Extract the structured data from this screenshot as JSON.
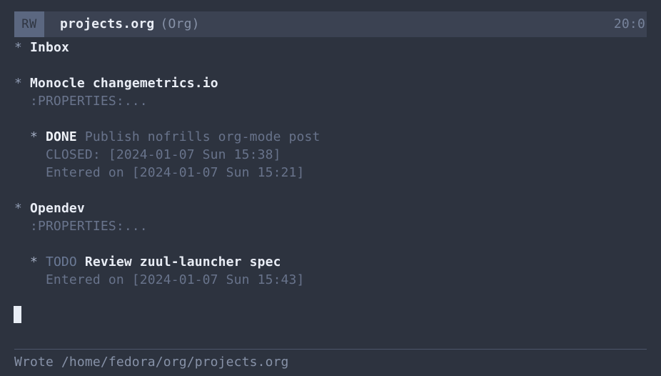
{
  "window": {
    "background_color": "#2d333f",
    "header": {
      "modified_badge": "RW",
      "file_name": "projects.org",
      "major_mode": "(Org)",
      "clock": "20:0",
      "bar_color": "#3b4252",
      "badge_color": "#5b6780"
    }
  },
  "buffer": {
    "lines": [
      {
        "bullet": "*",
        "text": "Inbox",
        "kind": "headline-1"
      },
      {
        "bullet": "",
        "text": "",
        "kind": "blank"
      },
      {
        "bullet": "*",
        "text": "Monocle changemetrics.io",
        "kind": "headline-1"
      },
      {
        "bullet": "",
        "text": ":PROPERTIES:...",
        "kind": "drawer"
      },
      {
        "bullet": "",
        "text": "",
        "kind": "blank"
      },
      {
        "bullet": "*",
        "keyword": "DONE",
        "text": "Publish nofrills org-mode post",
        "kind": "todo-item-done"
      },
      {
        "bullet": "",
        "text": "CLOSED: [2024-01-07 Sun 15:38]",
        "kind": "timestamp"
      },
      {
        "bullet": "",
        "text": "Entered on [2024-01-07 Sun 15:21]",
        "kind": "timestamp"
      },
      {
        "bullet": "",
        "text": "",
        "kind": "blank"
      },
      {
        "bullet": "*",
        "text": "Opendev",
        "kind": "headline-1"
      },
      {
        "bullet": "",
        "text": ":PROPERTIES:...",
        "kind": "drawer"
      },
      {
        "bullet": "",
        "text": "",
        "kind": "blank"
      },
      {
        "bullet": "*",
        "keyword": "TODO",
        "text": "Review zuul-launcher spec",
        "kind": "todo-item-todo"
      },
      {
        "bullet": "",
        "text": "Entered on [2024-01-07 Sun 15:43]",
        "kind": "timestamp"
      }
    ],
    "line_01_bullet": "*",
    "line_01_text": "Inbox",
    "line_03_bullet": "*",
    "line_03_text": "Monocle changemetrics.io",
    "line_04_text": "  :PROPERTIES:...",
    "line_06_bullet": "  * ",
    "line_06_keyword": "DONE",
    "line_06_text": " Publish nofrills org-mode post",
    "line_07_text": "    CLOSED: [2024-01-07 Sun 15:38]",
    "line_08_text": "    Entered on [2024-01-07 Sun 15:21]",
    "line_10_bullet": "*",
    "line_10_text": "Opendev",
    "line_11_text": "  :PROPERTIES:...",
    "line_13_bullet": "  * ",
    "line_13_keyword": "TODO",
    "line_13_text": " Review zuul-launcher spec",
    "line_14_text": "    Entered on [2024-01-07 Sun 15:43]"
  },
  "cursor": {
    "shape": "block",
    "color": "#e8edf5"
  },
  "minibuffer": {
    "message": "Wrote /home/fedora/org/projects.org"
  },
  "colors": {
    "foreground": "#e9edf5",
    "dimmed": "#68738b",
    "todo_keyword": "#6b7a96",
    "done_keyword": "#f0f3f8",
    "divider": "#4d566b"
  }
}
